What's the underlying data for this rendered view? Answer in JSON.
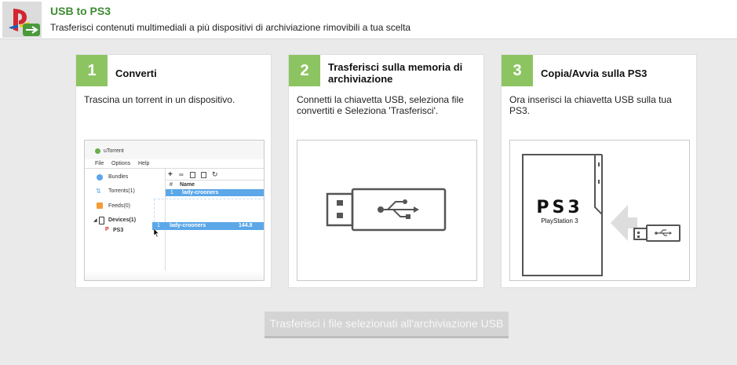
{
  "header": {
    "title": "USB to PS3",
    "subtitle": "Trasferisci contenuti multimediali a più dispositivi di archiviazione rimovibili a tua scelta"
  },
  "steps": [
    {
      "number": "1",
      "title": "Converti",
      "description": "Trascina un torrent in un dispositivo."
    },
    {
      "number": "2",
      "title": "Trasferisci sulla memoria di archiviazione",
      "description": "Connetti la chiavetta USB, seleziona file convertiti e Seleziona 'Trasferisci'."
    },
    {
      "number": "3",
      "title": "Copia/Avvia sulla PS3",
      "description": "Ora inserisci la chiavetta USB sulla tua PS3."
    }
  ],
  "utorrent_illustration": {
    "app_name": "uTorrent",
    "menu": [
      "File",
      "Options",
      "Help"
    ],
    "sidebar": [
      "Bundles",
      "Torrents(1)",
      "Feeds(0)",
      "Devices(1)",
      "PS3"
    ],
    "col_hash": "#",
    "col_name": "Name",
    "row_index": "1",
    "row_name": "lady-crooners",
    "drag_index": "1",
    "drag_name": "lady-crooners",
    "drag_size": "144.8"
  },
  "ps3_illustration": {
    "logo": "PS3",
    "label": "PlayStation 3"
  },
  "transfer_button": {
    "label": "Trasferisci i file selezionati all'archiviazione USB",
    "enabled": false
  },
  "colors": {
    "accent_green": "#8dc462",
    "title_green": "#3d8b32",
    "selection_blue": "#5ba7e8"
  }
}
